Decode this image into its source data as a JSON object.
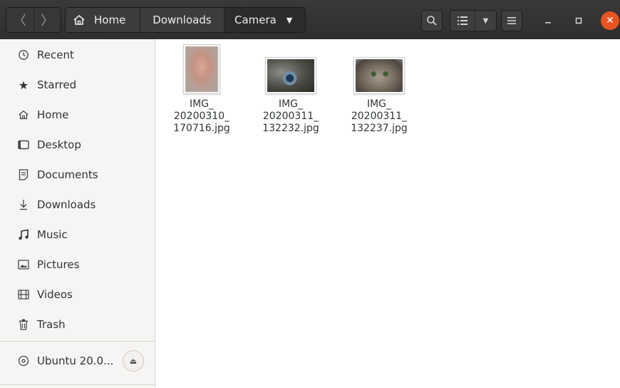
{
  "header": {
    "breadcrumbs": [
      {
        "label": "Home"
      },
      {
        "label": "Downloads"
      },
      {
        "label": "Camera"
      }
    ]
  },
  "sidebar": {
    "places": [
      {
        "label": "Recent",
        "icon": "clock-icon"
      },
      {
        "label": "Starred",
        "icon": "star-icon"
      },
      {
        "label": "Home",
        "icon": "home-icon"
      },
      {
        "label": "Desktop",
        "icon": "desktop-icon"
      },
      {
        "label": "Documents",
        "icon": "document-icon"
      },
      {
        "label": "Downloads",
        "icon": "download-icon"
      },
      {
        "label": "Music",
        "icon": "music-icon"
      },
      {
        "label": "Pictures",
        "icon": "picture-icon"
      },
      {
        "label": "Videos",
        "icon": "video-icon"
      },
      {
        "label": "Trash",
        "icon": "trash-icon"
      }
    ],
    "devices": [
      {
        "label": "Ubuntu 20.0...",
        "icon": "disc-icon"
      }
    ]
  },
  "files": [
    {
      "name": "IMG_\n20200310_\n170716.jpg"
    },
    {
      "name": "IMG_\n20200311_\n132232.jpg"
    },
    {
      "name": "IMG_\n20200311_\n132237.jpg"
    }
  ],
  "colors": {
    "headerbar": "#2f2d2d",
    "close_button": "#e95420",
    "sidebar_bg": "#f6f5f4"
  }
}
